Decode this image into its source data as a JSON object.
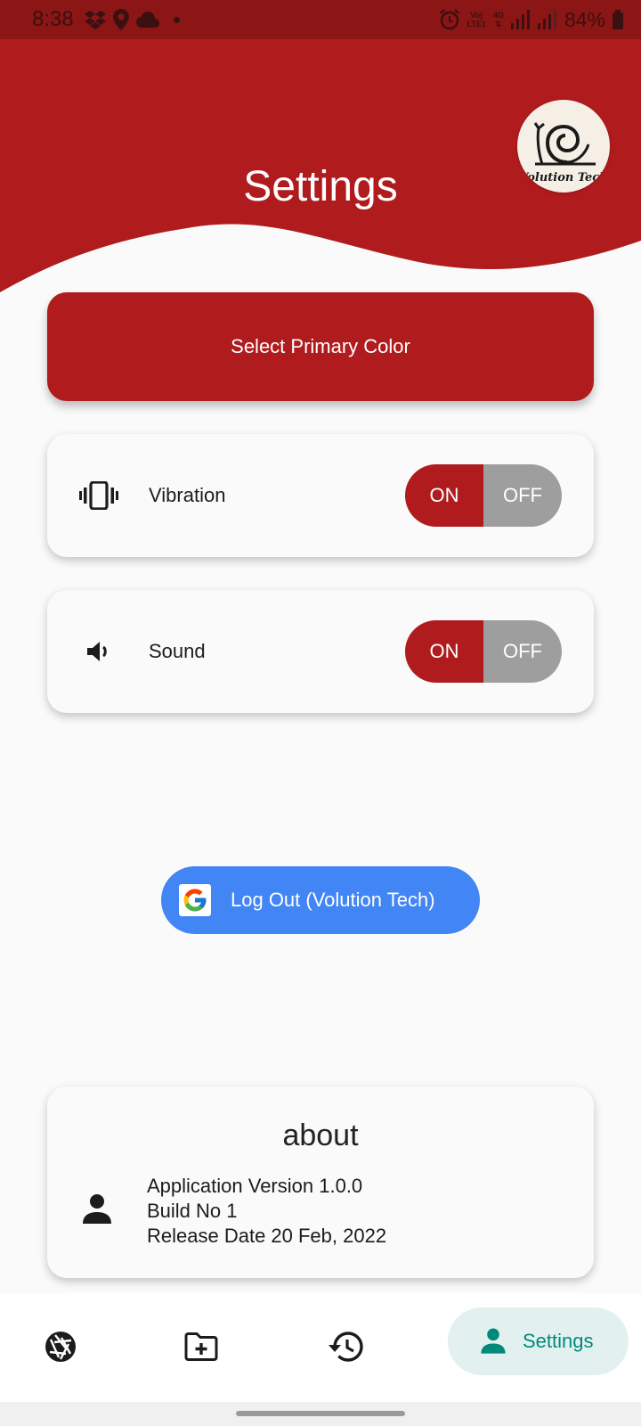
{
  "status_bar": {
    "time": "8:38",
    "lte_top": "Vo)",
    "lte_bottom": "LTE1",
    "net_top": "4G",
    "battery": "84%"
  },
  "header": {
    "title": "Settings",
    "logo_text": "Volution Tech"
  },
  "primary_color_button": {
    "label": "Select Primary Color"
  },
  "settings": {
    "vibration": {
      "label": "Vibration",
      "on_label": "ON",
      "off_label": "OFF",
      "state": "ON"
    },
    "sound": {
      "label": "Sound",
      "on_label": "ON",
      "off_label": "OFF",
      "state": "ON"
    }
  },
  "logout": {
    "label": "Log Out (Volution Tech)"
  },
  "about": {
    "title": "about",
    "version": "Application Version 1.0.0",
    "build": "Build No 1",
    "release": "Release Date 20 Feb, 2022"
  },
  "bottom_nav": {
    "items": [
      {
        "icon": "camera-shutter-icon"
      },
      {
        "icon": "folder-add-icon"
      },
      {
        "icon": "history-icon"
      },
      {
        "icon": "person-icon",
        "label": "Settings",
        "active": true
      }
    ]
  },
  "colors": {
    "primary": "#b01b1e",
    "status_bar": "#8c1515",
    "toggle_off": "#9e9e9e",
    "google_blue": "#4285f4",
    "nav_active_bg": "#e2f1f0",
    "nav_active_fg": "#00897b"
  }
}
